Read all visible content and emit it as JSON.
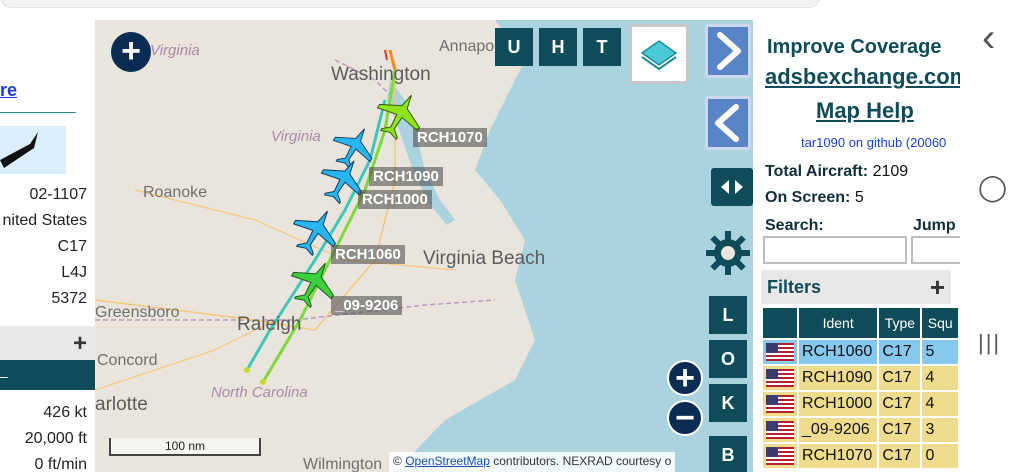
{
  "left_panel": {
    "link_fragment": "re",
    "rows": [
      "02-1107",
      "nited States",
      "C17",
      "L4J",
      "5372"
    ],
    "section_plus": "+",
    "section_dash": "–",
    "speed": "426 kt",
    "altitude": "20,000 ft",
    "vert_rate": "0 ft/min"
  },
  "map": {
    "cities": {
      "virginia_top": "Virginia",
      "annapolis": "Annapolis",
      "washington": "Washington",
      "virginia_mid": "Virginia",
      "roanoke": "Roanoke",
      "virginia_beach": "Virginia Beach",
      "greensboro": "Greensboro",
      "raleigh": "Raleigh",
      "concord": "Concord",
      "charlotte": "arlotte",
      "north_carolina": "North Carolina",
      "wilmington": "Wilmington"
    },
    "aircraft": [
      {
        "callsign": "RCH1070",
        "color": "#8fe21c"
      },
      {
        "callsign": "RCH1090",
        "color": "#29b6f0"
      },
      {
        "callsign": "RCH1000",
        "color": "#29b6f0"
      },
      {
        "callsign": "RCH1060",
        "color": "#29b6f0"
      },
      {
        "callsign": "_09-9206",
        "color": "#3ecf3e"
      }
    ],
    "buttons": {
      "u": "U",
      "h": "H",
      "t": "T",
      "zoom_in": "+",
      "zoom_out": "−",
      "add": "+",
      "l": "L",
      "o": "O",
      "k": "K",
      "b": "B"
    },
    "scale_label": "100 nm",
    "attribution_prefix": "© ",
    "attribution_link": "OpenStreetMap",
    "attribution_suffix": " contributors. NEXRAD courtesy o"
  },
  "right_panel": {
    "improve": "Improve Coverage",
    "site": "adsbexchange.com",
    "help": "Map Help",
    "github": "tar1090 on github (20060",
    "total_label": "Total Aircraft:",
    "total_value": "2109",
    "onscreen_label": "On Screen:",
    "onscreen_value": "5",
    "search_label": "Search:",
    "jump_label": "Jump",
    "filters_label": "Filters",
    "filters_plus": "+",
    "table": {
      "headers": [
        "",
        "Ident",
        "Type",
        "Squ"
      ],
      "rows": [
        {
          "ident": "RCH1060",
          "type": "C17",
          "squawk": "5",
          "selected": true
        },
        {
          "ident": "RCH1090",
          "type": "C17",
          "squawk": "4",
          "selected": false
        },
        {
          "ident": "RCH1000",
          "type": "C17",
          "squawk": "4",
          "selected": false
        },
        {
          "ident": "_09-9206",
          "type": "C17",
          "squawk": "3",
          "selected": false
        },
        {
          "ident": "RCH1070",
          "type": "C17",
          "squawk": "0",
          "selected": false
        }
      ]
    }
  },
  "android_nav": {
    "back": "‹",
    "home": "◯",
    "recents": "|||"
  },
  "colors": {
    "teal": "#0e4c5a",
    "navy": "#0b2c52",
    "selected_row": "#86c8ee",
    "row": "#efdc8c"
  }
}
